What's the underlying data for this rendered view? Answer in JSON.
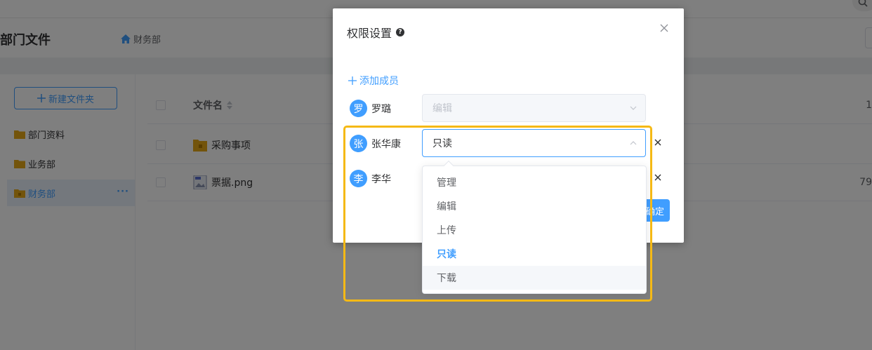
{
  "header": {
    "page_title": "部门文件",
    "breadcrumb": "财务部"
  },
  "sidebar": {
    "new_folder_label": "新建文件夹",
    "items": [
      {
        "label": "部门资料"
      },
      {
        "label": "业务部"
      },
      {
        "label": "财务部",
        "more": "···"
      }
    ]
  },
  "file_list": {
    "column_name": "文件名",
    "rows": [
      {
        "name": "采购事项",
        "size": ""
      },
      {
        "name": "票据.png",
        "size": "79"
      }
    ],
    "header_size": "1"
  },
  "dialog": {
    "title": "权限设置",
    "help_glyph": "?",
    "add_member_label": "添加成员",
    "members": [
      {
        "avatar": "罗",
        "name": "罗璐",
        "permission": "编辑",
        "disabled": true
      },
      {
        "avatar": "张",
        "name": "张华康",
        "permission": "只读",
        "disabled": false
      },
      {
        "avatar": "李",
        "name": "李华",
        "permission": "",
        "disabled": false
      }
    ],
    "confirm_label": "确定"
  },
  "dropdown": {
    "options": [
      {
        "label": "管理"
      },
      {
        "label": "编辑"
      },
      {
        "label": "上传"
      },
      {
        "label": "只读",
        "selected": true
      },
      {
        "label": "下载",
        "hover": true
      }
    ]
  },
  "colors": {
    "accent": "#409eff",
    "highlight": "#f5b915",
    "folder": "#e6a817"
  }
}
